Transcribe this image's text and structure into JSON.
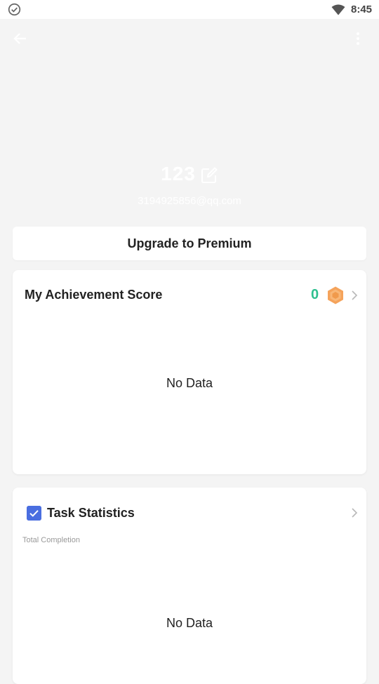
{
  "status_bar": {
    "time": "8:45",
    "icons": [
      "check-circle-icon",
      "wifi-icon"
    ]
  },
  "top_bar": {
    "icons": [
      "back-arrow-icon",
      "more-vertical-icon"
    ]
  },
  "profile": {
    "name": "123",
    "email": "3194925856@qq.com",
    "edit_icon": "edit-icon"
  },
  "premium": {
    "label": "Upgrade to Premium"
  },
  "achievement": {
    "title": "My Achievement Score",
    "score": "0",
    "score_color": "#2fc08f",
    "badge_icon": "hexagon-badge-icon",
    "badge_color": "#f5a35b",
    "empty_text": "No Data"
  },
  "tasks": {
    "title": "Task Statistics",
    "subtitle": "Total Completion",
    "check_color": "#4a6ee0",
    "empty_text": "No Data"
  },
  "colors": {
    "background": "#f4f4f4",
    "card": "#ffffff",
    "text_primary": "#222222",
    "text_secondary": "#999999"
  }
}
